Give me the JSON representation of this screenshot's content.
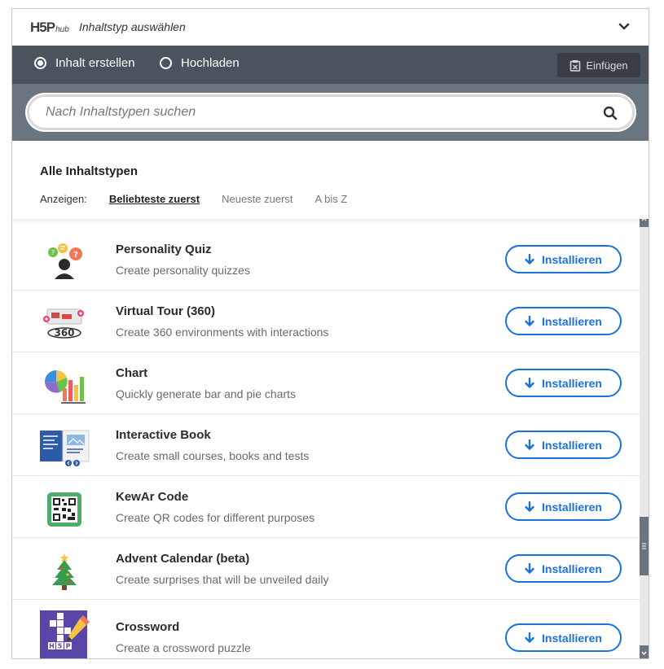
{
  "header": {
    "logo_text": "H5P",
    "logo_sub": "hub",
    "title": "Inhaltstyp auswählen"
  },
  "tabs": {
    "create_label": "Inhalt erstellen",
    "upload_label": "Hochladen",
    "paste_label": "Einfügen"
  },
  "search": {
    "placeholder": "Nach Inhaltstypen suchen"
  },
  "list_header": {
    "title": "Alle Inhaltstypen",
    "show_label": "Anzeigen:",
    "sort_popular": "Beliebteste zuerst",
    "sort_newest": "Neueste zuerst",
    "sort_az": "A bis Z"
  },
  "colors": {
    "accent": "#1a73d9",
    "tabbar": "#4b535e",
    "searcharea": "#6b7580"
  },
  "items": [
    {
      "title": "Personality Quiz",
      "description": "Create personality quizzes",
      "button": "Installieren",
      "icon": "personality-quiz-icon"
    },
    {
      "title": "Virtual Tour (360)",
      "description": "Create 360 environments with interactions",
      "button": "Installieren",
      "icon": "virtual-tour-icon"
    },
    {
      "title": "Chart",
      "description": "Quickly generate bar and pie charts",
      "button": "Installieren",
      "icon": "chart-icon"
    },
    {
      "title": "Interactive Book",
      "description": "Create small courses, books and tests",
      "button": "Installieren",
      "icon": "interactive-book-icon"
    },
    {
      "title": "KewAr Code",
      "description": "Create QR codes for different purposes",
      "button": "Installieren",
      "icon": "qr-code-icon"
    },
    {
      "title": "Advent Calendar (beta)",
      "description": "Create surprises that will be unveiled daily",
      "button": "Installieren",
      "icon": "christmas-tree-icon"
    },
    {
      "title": "Crossword",
      "description": "Create a crossword puzzle",
      "button": "Installieren",
      "icon": "crossword-icon"
    }
  ]
}
